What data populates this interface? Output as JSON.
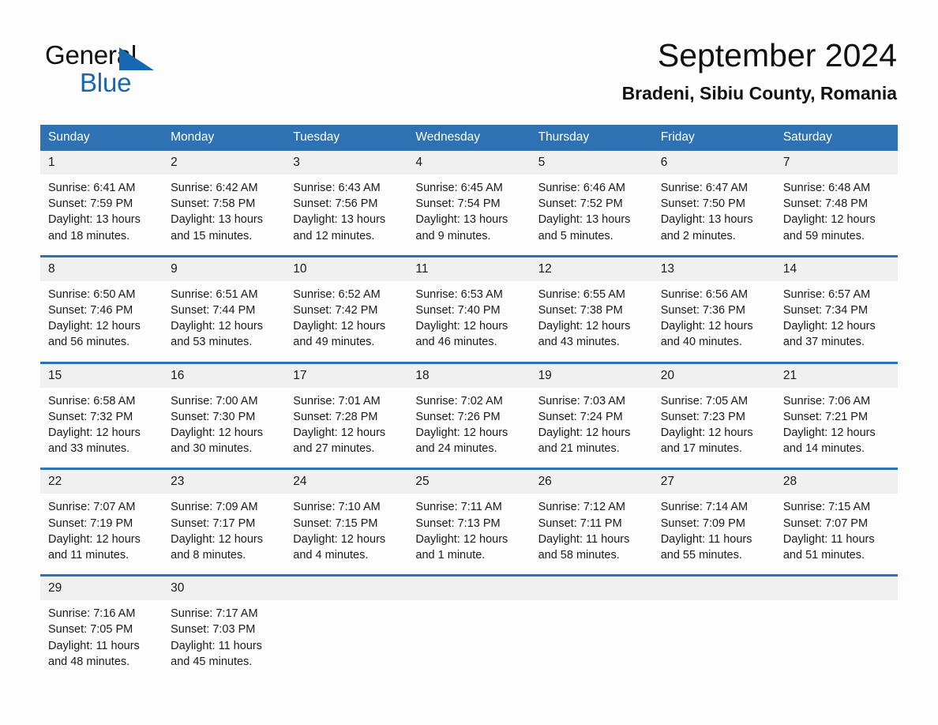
{
  "logo": {
    "line1": "General",
    "line2": "Blue",
    "triangle_color": "#1668b3"
  },
  "header": {
    "title": "September 2024",
    "subtitle": "Bradeni, Sibiu County, Romania"
  },
  "theme": {
    "accent": "#2e72b4",
    "daynum_background": "#f0f0f0",
    "header_text": "#ffffff",
    "page_background": "#fdfdfd"
  },
  "weekdays": [
    "Sunday",
    "Monday",
    "Tuesday",
    "Wednesday",
    "Thursday",
    "Friday",
    "Saturday"
  ],
  "weeks": [
    [
      {
        "day": "1",
        "sunrise": "Sunrise: 6:41 AM",
        "sunset": "Sunset: 7:59 PM",
        "daylight": "Daylight: 13 hours and 18 minutes."
      },
      {
        "day": "2",
        "sunrise": "Sunrise: 6:42 AM",
        "sunset": "Sunset: 7:58 PM",
        "daylight": "Daylight: 13 hours and 15 minutes."
      },
      {
        "day": "3",
        "sunrise": "Sunrise: 6:43 AM",
        "sunset": "Sunset: 7:56 PM",
        "daylight": "Daylight: 13 hours and 12 minutes."
      },
      {
        "day": "4",
        "sunrise": "Sunrise: 6:45 AM",
        "sunset": "Sunset: 7:54 PM",
        "daylight": "Daylight: 13 hours and 9 minutes."
      },
      {
        "day": "5",
        "sunrise": "Sunrise: 6:46 AM",
        "sunset": "Sunset: 7:52 PM",
        "daylight": "Daylight: 13 hours and 5 minutes."
      },
      {
        "day": "6",
        "sunrise": "Sunrise: 6:47 AM",
        "sunset": "Sunset: 7:50 PM",
        "daylight": "Daylight: 13 hours and 2 minutes."
      },
      {
        "day": "7",
        "sunrise": "Sunrise: 6:48 AM",
        "sunset": "Sunset: 7:48 PM",
        "daylight": "Daylight: 12 hours and 59 minutes."
      }
    ],
    [
      {
        "day": "8",
        "sunrise": "Sunrise: 6:50 AM",
        "sunset": "Sunset: 7:46 PM",
        "daylight": "Daylight: 12 hours and 56 minutes."
      },
      {
        "day": "9",
        "sunrise": "Sunrise: 6:51 AM",
        "sunset": "Sunset: 7:44 PM",
        "daylight": "Daylight: 12 hours and 53 minutes."
      },
      {
        "day": "10",
        "sunrise": "Sunrise: 6:52 AM",
        "sunset": "Sunset: 7:42 PM",
        "daylight": "Daylight: 12 hours and 49 minutes."
      },
      {
        "day": "11",
        "sunrise": "Sunrise: 6:53 AM",
        "sunset": "Sunset: 7:40 PM",
        "daylight": "Daylight: 12 hours and 46 minutes."
      },
      {
        "day": "12",
        "sunrise": "Sunrise: 6:55 AM",
        "sunset": "Sunset: 7:38 PM",
        "daylight": "Daylight: 12 hours and 43 minutes."
      },
      {
        "day": "13",
        "sunrise": "Sunrise: 6:56 AM",
        "sunset": "Sunset: 7:36 PM",
        "daylight": "Daylight: 12 hours and 40 minutes."
      },
      {
        "day": "14",
        "sunrise": "Sunrise: 6:57 AM",
        "sunset": "Sunset: 7:34 PM",
        "daylight": "Daylight: 12 hours and 37 minutes."
      }
    ],
    [
      {
        "day": "15",
        "sunrise": "Sunrise: 6:58 AM",
        "sunset": "Sunset: 7:32 PM",
        "daylight": "Daylight: 12 hours and 33 minutes."
      },
      {
        "day": "16",
        "sunrise": "Sunrise: 7:00 AM",
        "sunset": "Sunset: 7:30 PM",
        "daylight": "Daylight: 12 hours and 30 minutes."
      },
      {
        "day": "17",
        "sunrise": "Sunrise: 7:01 AM",
        "sunset": "Sunset: 7:28 PM",
        "daylight": "Daylight: 12 hours and 27 minutes."
      },
      {
        "day": "18",
        "sunrise": "Sunrise: 7:02 AM",
        "sunset": "Sunset: 7:26 PM",
        "daylight": "Daylight: 12 hours and 24 minutes."
      },
      {
        "day": "19",
        "sunrise": "Sunrise: 7:03 AM",
        "sunset": "Sunset: 7:24 PM",
        "daylight": "Daylight: 12 hours and 21 minutes."
      },
      {
        "day": "20",
        "sunrise": "Sunrise: 7:05 AM",
        "sunset": "Sunset: 7:23 PM",
        "daylight": "Daylight: 12 hours and 17 minutes."
      },
      {
        "day": "21",
        "sunrise": "Sunrise: 7:06 AM",
        "sunset": "Sunset: 7:21 PM",
        "daylight": "Daylight: 12 hours and 14 minutes."
      }
    ],
    [
      {
        "day": "22",
        "sunrise": "Sunrise: 7:07 AM",
        "sunset": "Sunset: 7:19 PM",
        "daylight": "Daylight: 12 hours and 11 minutes."
      },
      {
        "day": "23",
        "sunrise": "Sunrise: 7:09 AM",
        "sunset": "Sunset: 7:17 PM",
        "daylight": "Daylight: 12 hours and 8 minutes."
      },
      {
        "day": "24",
        "sunrise": "Sunrise: 7:10 AM",
        "sunset": "Sunset: 7:15 PM",
        "daylight": "Daylight: 12 hours and 4 minutes."
      },
      {
        "day": "25",
        "sunrise": "Sunrise: 7:11 AM",
        "sunset": "Sunset: 7:13 PM",
        "daylight": "Daylight: 12 hours and 1 minute."
      },
      {
        "day": "26",
        "sunrise": "Sunrise: 7:12 AM",
        "sunset": "Sunset: 7:11 PM",
        "daylight": "Daylight: 11 hours and 58 minutes."
      },
      {
        "day": "27",
        "sunrise": "Sunrise: 7:14 AM",
        "sunset": "Sunset: 7:09 PM",
        "daylight": "Daylight: 11 hours and 55 minutes."
      },
      {
        "day": "28",
        "sunrise": "Sunrise: 7:15 AM",
        "sunset": "Sunset: 7:07 PM",
        "daylight": "Daylight: 11 hours and 51 minutes."
      }
    ],
    [
      {
        "day": "29",
        "sunrise": "Sunrise: 7:16 AM",
        "sunset": "Sunset: 7:05 PM",
        "daylight": "Daylight: 11 hours and 48 minutes."
      },
      {
        "day": "30",
        "sunrise": "Sunrise: 7:17 AM",
        "sunset": "Sunset: 7:03 PM",
        "daylight": "Daylight: 11 hours and 45 minutes."
      },
      {
        "day": "",
        "sunrise": "",
        "sunset": "",
        "daylight": ""
      },
      {
        "day": "",
        "sunrise": "",
        "sunset": "",
        "daylight": ""
      },
      {
        "day": "",
        "sunrise": "",
        "sunset": "",
        "daylight": ""
      },
      {
        "day": "",
        "sunrise": "",
        "sunset": "",
        "daylight": ""
      },
      {
        "day": "",
        "sunrise": "",
        "sunset": "",
        "daylight": ""
      }
    ]
  ]
}
